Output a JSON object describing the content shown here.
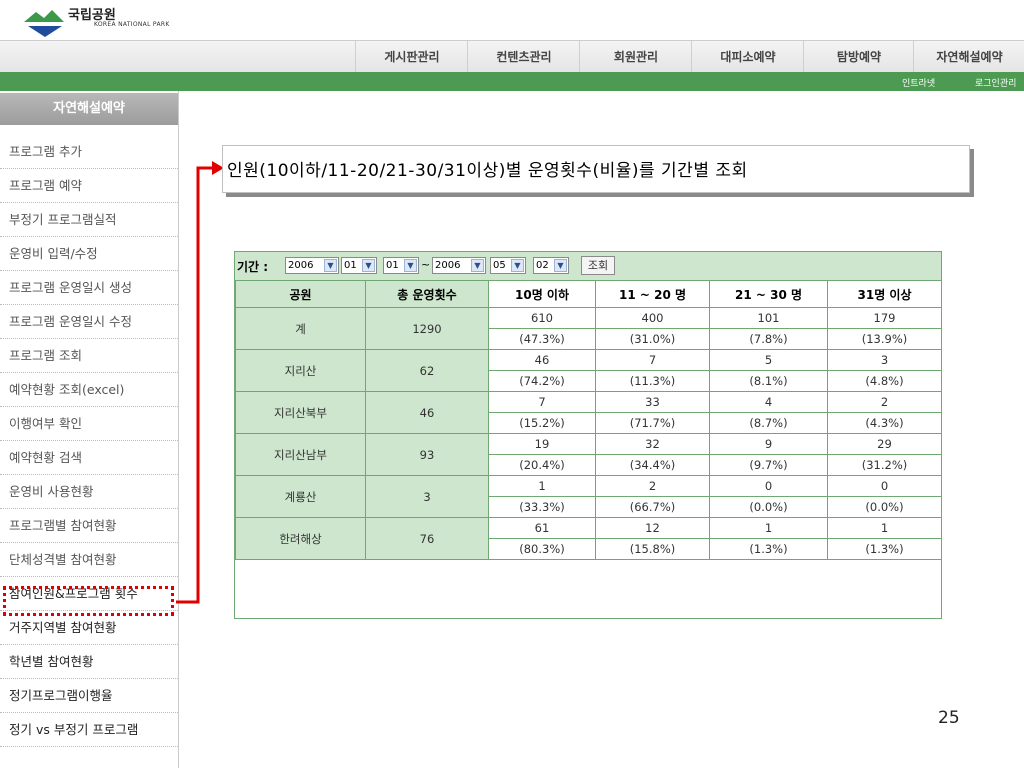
{
  "logo": {
    "title": "국립공원",
    "subtitle": "KOREA NATIONAL PARK"
  },
  "menu": [
    "게시판관리",
    "컨텐츠관리",
    "회원관리",
    "대피소예약",
    "탐방예약",
    "자연해설예약"
  ],
  "util_links": [
    "인트라넷",
    "로그인관리"
  ],
  "sidebar": {
    "title": "자연해설예약",
    "items": [
      "프로그램 추가",
      "프로그램 예약",
      "부정기 프로그램실적",
      "운영비 입력/수정",
      "프로그램 운영일시 생성",
      "프로그램 운영일시 수정",
      "프로그램 조회",
      "예약현황 조회(excel)",
      "이행여부 확인",
      "예약현황 검색",
      "운영비 사용현황",
      "프로그램별 참여현황",
      "단체성격별 참여현황",
      "참여인원&프로그램 횟수",
      "거주지역별 참여현황",
      "학년별 참여현황",
      "정기프로그램이행율",
      "정기 vs 부정기 프로그램"
    ],
    "selected_index": 13
  },
  "heading": "인원(10이하/11-20/21-30/31이상)별 운영횟수(비율)를 기간별 조회",
  "filter": {
    "label": "기간 :",
    "from_year": "2006",
    "from_month": "01",
    "from_day": "01",
    "separator": "~",
    "to_year": "2006",
    "to_month": "05",
    "to_day": "02",
    "query_button": "조회"
  },
  "table": {
    "headers": [
      "공원",
      "총 운영횟수",
      "10명 이하",
      "11 ~ 20 명",
      "21 ~ 30 명",
      "31명 이상"
    ],
    "rows": [
      {
        "park": "계",
        "total": "1290",
        "counts": [
          "610",
          "400",
          "101",
          "179"
        ],
        "ratios": [
          "(47.3%)",
          "(31.0%)",
          "(7.8%)",
          "(13.9%)"
        ]
      },
      {
        "park": "지리산",
        "total": "62",
        "counts": [
          "46",
          "7",
          "5",
          "3"
        ],
        "ratios": [
          "(74.2%)",
          "(11.3%)",
          "(8.1%)",
          "(4.8%)"
        ]
      },
      {
        "park": "지리산북부",
        "total": "46",
        "counts": [
          "7",
          "33",
          "4",
          "2"
        ],
        "ratios": [
          "(15.2%)",
          "(71.7%)",
          "(8.7%)",
          "(4.3%)"
        ]
      },
      {
        "park": "지리산남부",
        "total": "93",
        "counts": [
          "19",
          "32",
          "9",
          "29"
        ],
        "ratios": [
          "(20.4%)",
          "(34.4%)",
          "(9.7%)",
          "(31.2%)"
        ]
      },
      {
        "park": "계룡산",
        "total": "3",
        "counts": [
          "1",
          "2",
          "0",
          "0"
        ],
        "ratios": [
          "(33.3%)",
          "(66.7%)",
          "(0.0%)",
          "(0.0%)"
        ]
      },
      {
        "park": "한려해상",
        "total": "76",
        "counts": [
          "61",
          "12",
          "1",
          "1"
        ],
        "ratios": [
          "(80.3%)",
          "(15.8%)",
          "(1.3%)",
          "(1.3%)"
        ]
      }
    ]
  },
  "page_number": "25",
  "colors": {
    "green_bar": "#4d9b52",
    "table_green": "#cde6cd",
    "highlight_red": "#e10000"
  }
}
